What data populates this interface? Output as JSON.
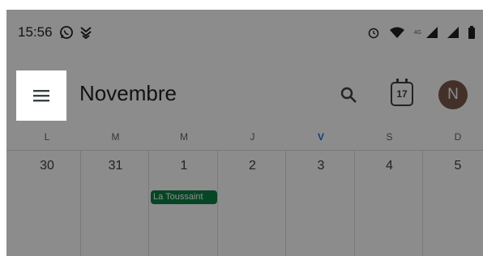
{
  "status_bar": {
    "time": "15:56",
    "left_icons": [
      "whatsapp-icon",
      "notification-icon"
    ],
    "right_icons": [
      "alarm-icon",
      "wifi-icon",
      "signal-icon",
      "signal-icon",
      "battery-icon"
    ],
    "network_label": "4G"
  },
  "app_bar": {
    "menu_icon": "menu-icon",
    "title": "Novembre",
    "search_icon": "search-icon",
    "today_date": "17",
    "avatar_initial": "N"
  },
  "week": {
    "days": [
      "L",
      "M",
      "M",
      "J",
      "V",
      "S",
      "D"
    ],
    "today_index": 4,
    "dates": [
      "30",
      "31",
      "1",
      "2",
      "3",
      "4",
      "5"
    ]
  },
  "events": [
    {
      "label": "La Toussaint",
      "day_index": 2,
      "color": "#0b8043"
    }
  ],
  "colors": {
    "today_accent": "#1a73e8",
    "avatar_bg": "#7b5a4b",
    "scrim": "rgba(0,0,0,0.45)"
  }
}
